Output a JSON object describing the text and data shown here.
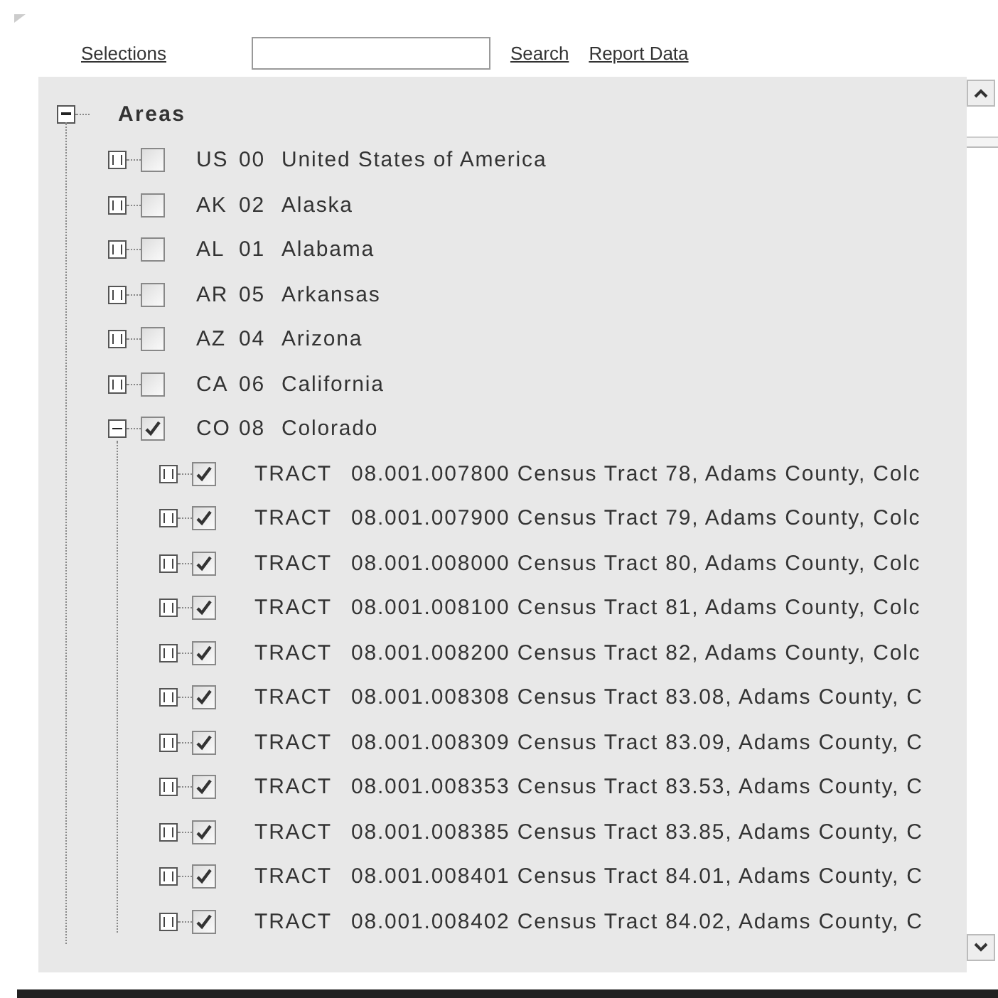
{
  "toolbar": {
    "links": [
      "Selections",
      "Search",
      "Report Data"
    ]
  },
  "tree": {
    "label": "Areas",
    "expanded": true,
    "children": [
      {
        "code": "US",
        "number": "00",
        "name": "United States of America",
        "expanded": false,
        "checked": false
      },
      {
        "code": "AK",
        "number": "02",
        "name": "Alaska",
        "expanded": false,
        "checked": false
      },
      {
        "code": "AL",
        "number": "01",
        "name": "Alabama",
        "expanded": false,
        "checked": false
      },
      {
        "code": "AR",
        "number": "05",
        "name": "Arkansas",
        "expanded": false,
        "checked": false
      },
      {
        "code": "AZ",
        "number": "04",
        "name": "Arizona",
        "expanded": false,
        "checked": false
      },
      {
        "code": "CA",
        "number": "06",
        "name": "California",
        "expanded": false,
        "checked": false
      },
      {
        "code": "CO",
        "number": "08",
        "name": "Colorado",
        "expanded": true,
        "checked": true,
        "children": [
          {
            "code": "TRACT",
            "name": "08.001.007800 Census Tract 78, Adams County, Colc",
            "expanded": false,
            "checked": true
          },
          {
            "code": "TRACT",
            "name": "08.001.007900 Census Tract 79, Adams County, Colc",
            "expanded": false,
            "checked": true
          },
          {
            "code": "TRACT",
            "name": "08.001.008000 Census Tract 80, Adams County, Colc",
            "expanded": false,
            "checked": true
          },
          {
            "code": "TRACT",
            "name": "08.001.008100 Census Tract 81, Adams County, Colc",
            "expanded": false,
            "checked": true
          },
          {
            "code": "TRACT",
            "name": "08.001.008200 Census Tract 82, Adams County, Colc",
            "expanded": false,
            "checked": true
          },
          {
            "code": "TRACT",
            "name": "08.001.008308 Census Tract 83.08, Adams County, C",
            "expanded": false,
            "checked": true
          },
          {
            "code": "TRACT",
            "name": "08.001.008309 Census Tract 83.09, Adams County, C",
            "expanded": false,
            "checked": true
          },
          {
            "code": "TRACT",
            "name": "08.001.008353 Census Tract 83.53, Adams County, C",
            "expanded": false,
            "checked": true
          },
          {
            "code": "TRACT",
            "name": "08.001.008385 Census Tract 83.85, Adams County, C",
            "expanded": false,
            "checked": true
          },
          {
            "code": "TRACT",
            "name": "08.001.008401 Census Tract 84.01, Adams County, C",
            "expanded": false,
            "checked": true
          },
          {
            "code": "TRACT",
            "name": "08.001.008402 Census Tract 84.02, Adams County, C",
            "expanded": false,
            "checked": true
          }
        ]
      }
    ]
  }
}
